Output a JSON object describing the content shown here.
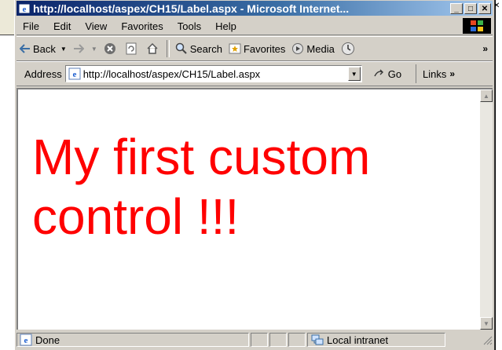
{
  "window": {
    "title": "http://localhost/aspex/CH15/Label.aspx - Microsoft Internet...",
    "buttons": {
      "minimize": "_",
      "maximize": "□",
      "close": "✕"
    }
  },
  "menu": [
    "File",
    "Edit",
    "View",
    "Favorites",
    "Tools",
    "Help"
  ],
  "toolbar": {
    "back": "Back",
    "search": "Search",
    "favorites": "Favorites",
    "media": "Media",
    "more": "»"
  },
  "address": {
    "label": "Address",
    "url": "http://localhost/aspex/CH15/Label.aspx",
    "go": "Go",
    "links": "Links",
    "links_more": "»"
  },
  "page": {
    "text": "My first custom control !!!",
    "color": "#ff0000"
  },
  "status": {
    "text": "Done",
    "zone": "Local intranet"
  },
  "colors": {
    "title_gradient_start": "#0a246a",
    "title_gradient_end": "#a6caf0",
    "chrome": "#d4d0c8"
  }
}
